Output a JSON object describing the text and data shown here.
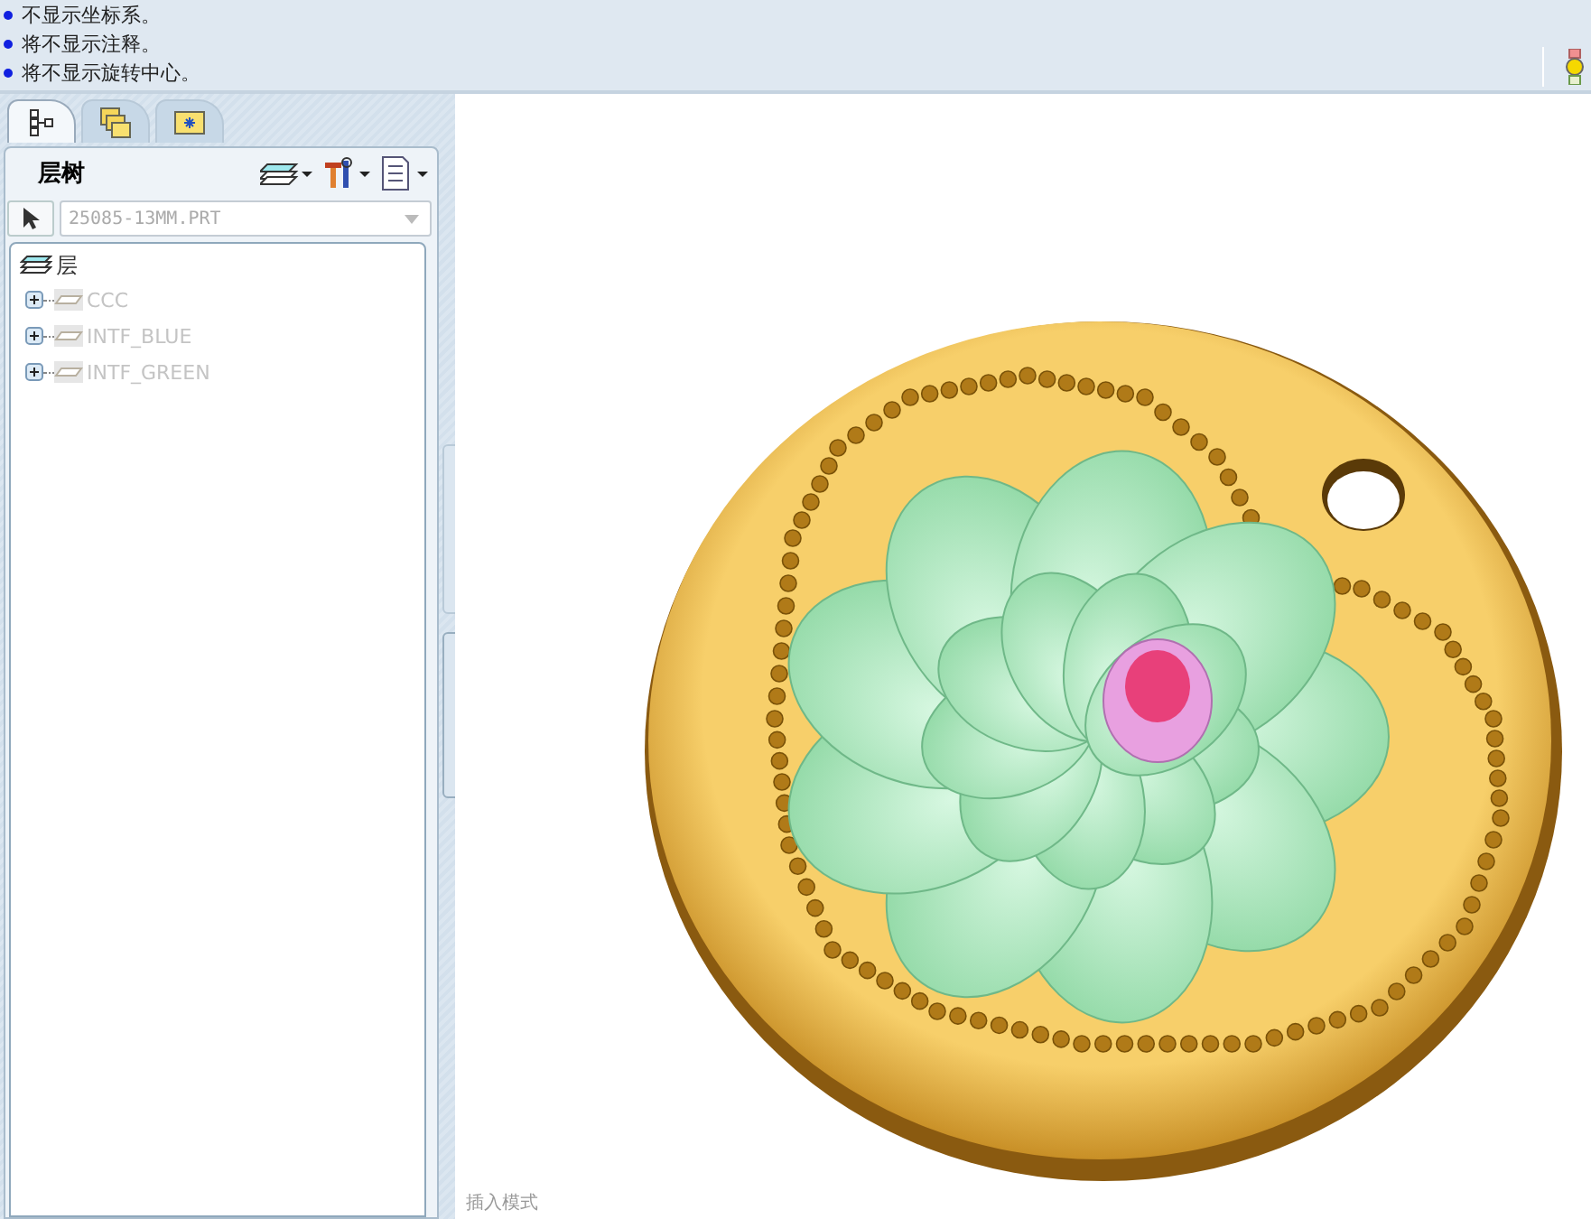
{
  "messages": [
    "不显示坐标系。",
    "将不显示注释。",
    "将不显示旋转中心。"
  ],
  "tabs": [
    {
      "kind": "tree",
      "selected": true
    },
    {
      "kind": "folders",
      "selected": false
    },
    {
      "kind": "favorites",
      "selected": false
    }
  ],
  "panel": {
    "title": "层树",
    "model_field": {
      "value": "25085-13MM.PRT"
    }
  },
  "tree": {
    "label": "层",
    "children": [
      {
        "label": "CCC",
        "expanded": false
      },
      {
        "label": "INTF_BLUE",
        "expanded": false
      },
      {
        "label": "INTF_GREEN",
        "expanded": false
      }
    ]
  },
  "status_text": "插入模式"
}
